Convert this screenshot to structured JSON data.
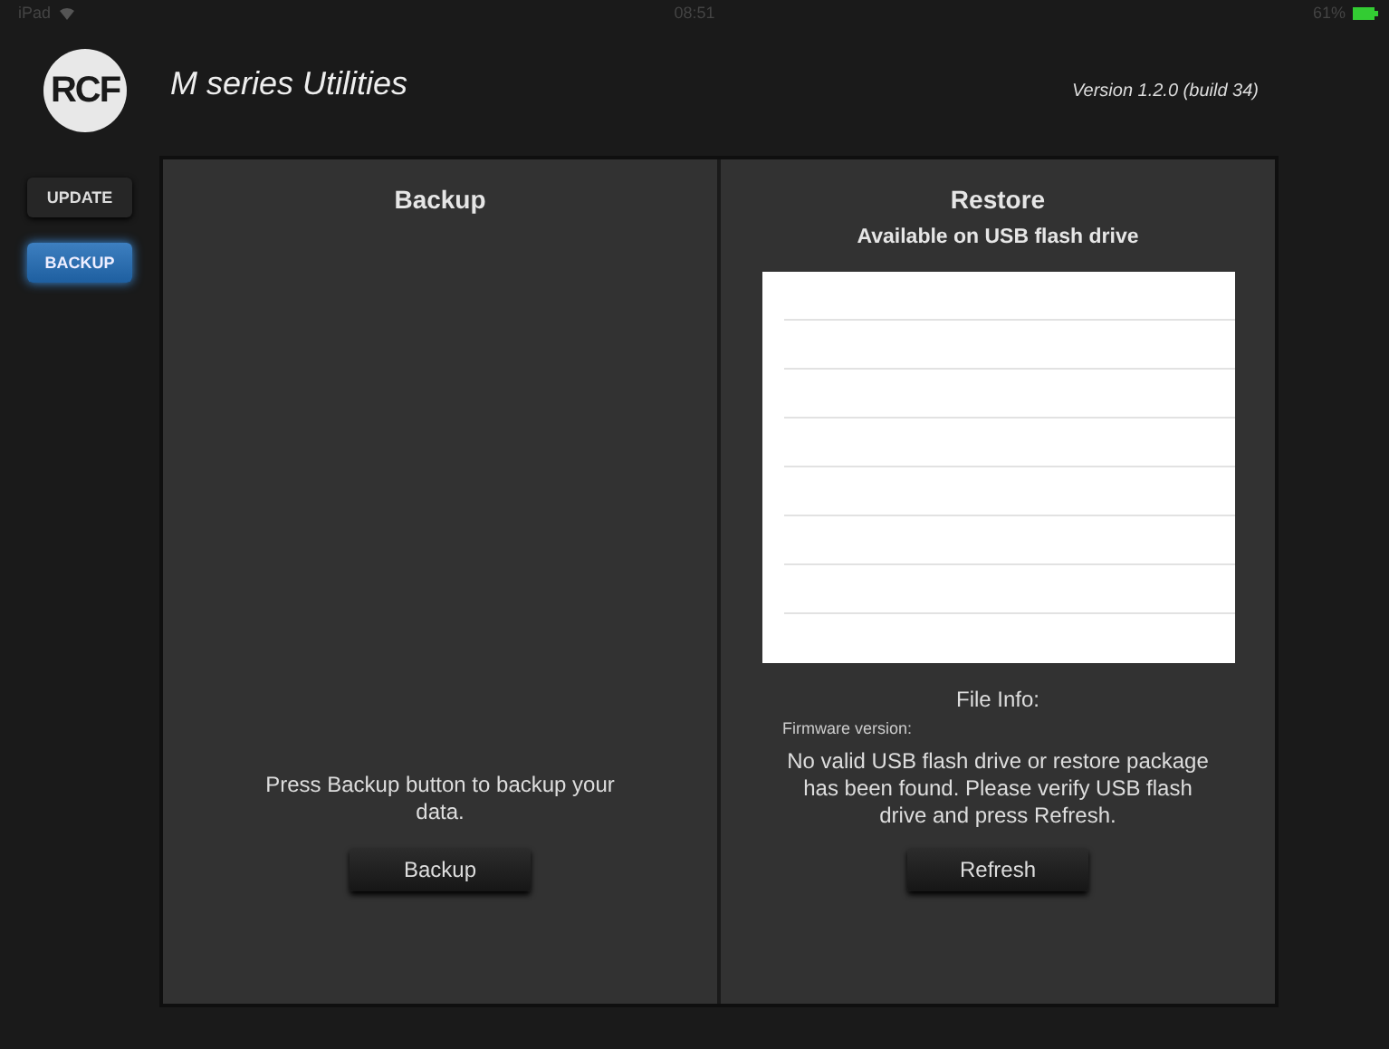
{
  "status_bar": {
    "device": "iPad",
    "time": "08:51",
    "battery": "61%"
  },
  "header": {
    "logo": "RCF",
    "title": "M series Utilities",
    "version": "Version 1.2.0 (build 34)"
  },
  "sidebar": {
    "items": [
      {
        "label": "UPDATE",
        "selected": false
      },
      {
        "label": "BACKUP",
        "selected": true
      }
    ]
  },
  "backup": {
    "title": "Backup",
    "message": "Press Backup button to backup your data.",
    "button": "Backup"
  },
  "restore": {
    "title": "Restore",
    "subtitle": "Available on USB flash drive",
    "file_info": "File Info:",
    "firmware_label": "Firmware version:",
    "message": "No valid USB flash drive or restore package has been found. Please verify USB flash drive and press Refresh.",
    "button": "Refresh"
  }
}
